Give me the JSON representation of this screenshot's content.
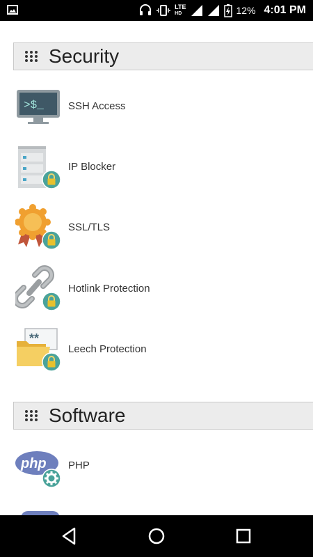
{
  "status_bar": {
    "network_label": "LTE",
    "network_hd": "HD",
    "battery": "12%",
    "time": "4:01 PM"
  },
  "sections": {
    "security": {
      "title": "Security",
      "items": [
        {
          "label": "SSH Access",
          "icon": "terminal-icon"
        },
        {
          "label": "IP Blocker",
          "icon": "server-lock-icon"
        },
        {
          "label": "SSL/TLS",
          "icon": "certificate-lock-icon"
        },
        {
          "label": "Hotlink Protection",
          "icon": "link-lock-icon"
        },
        {
          "label": "Leech Protection",
          "icon": "folder-lock-icon"
        }
      ]
    },
    "software": {
      "title": "Software",
      "items": [
        {
          "label": "PHP",
          "icon": "php-gear-icon"
        }
      ]
    }
  },
  "colors": {
    "lock_badge": "#4aa39a",
    "lock_body": "#e8c12d",
    "header_bg": "#ececec"
  }
}
